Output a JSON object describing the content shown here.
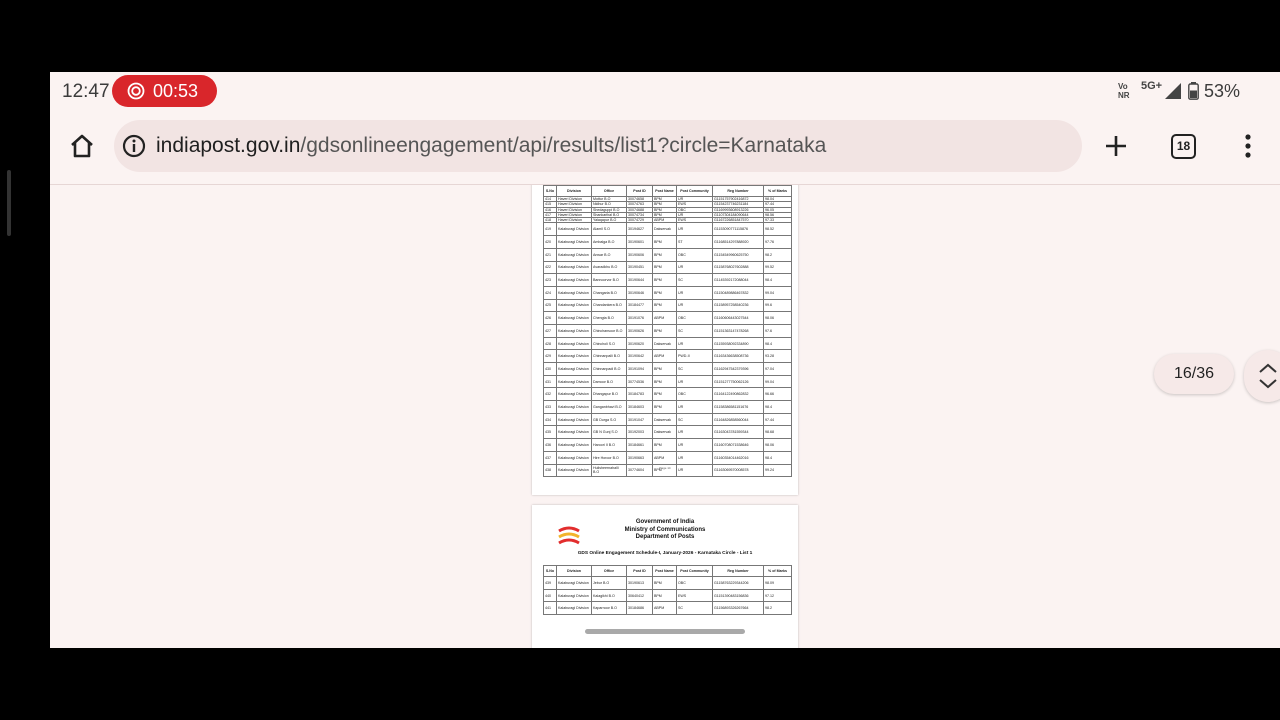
{
  "status_bar": {
    "time": "12:47",
    "recording_time": "00:53",
    "network_type": "Vo\nNR",
    "network_gen": "5G+",
    "battery": "53%"
  },
  "browser": {
    "url_domain": "indiapost.gov.in",
    "url_path": "/gdsonlineengagement/api/results/list1?circle=Karnataka",
    "tab_count": "18",
    "icons": {
      "home": "home-icon",
      "info": "info-icon",
      "new_tab": "plus-icon",
      "menu": "more-vert-icon"
    }
  },
  "pdf": {
    "page_indicator": "16/36",
    "columns": [
      "S.No",
      "Division",
      "Office",
      "Post ID",
      "Post Name",
      "Post Community",
      "Reg Number",
      "% of Marks"
    ],
    "page_a_rows": [
      [
        "414",
        "Haveri Division",
        "Mottur B.O",
        "30074658",
        "BPM",
        "UR",
        "G1151757902416872",
        "98.04"
      ],
      [
        "415",
        "Haveri Division",
        "Nidhur B.O",
        "30074763",
        "BPM",
        "EWS",
        "G1154237746231184",
        "97.44"
      ],
      [
        "416",
        "Haveri Division",
        "Shedaguppi B.O",
        "30074688",
        "BPM",
        "OBC",
        "G1169993608913226",
        "96.05"
      ],
      [
        "417",
        "Haveri Division",
        "Shankarihal B.O",
        "30074734",
        "BPM",
        "UR",
        "G1107304184090644",
        "98.56"
      ],
      [
        "418",
        "Haveri Division",
        "Yalaqapur B.O",
        "30074729",
        "ABPM",
        "EWS",
        "G1167226851847570",
        "97.33"
      ],
      [
        "419",
        "Kalaburagi Division",
        "Alamil S.O",
        "30194627",
        "Dakservak",
        "UR",
        "G1153090771115876",
        "98.52"
      ],
      [
        "420",
        "Kalaburagi Division",
        "Ambalga B.O",
        "30190601",
        "BPM",
        "ST",
        "G1168514297888920",
        "97.76"
      ],
      [
        "421",
        "Kalaburagi Division",
        "Anwar B.O",
        "30190606",
        "BPM",
        "OBC",
        "G1154549960625750",
        "98.2"
      ],
      [
        "422",
        "Kalaburagi Division",
        "Avaradkhu B.O",
        "30190451",
        "BPM",
        "UR",
        "G1158768027602888",
        "99.52"
      ],
      [
        "423",
        "Kalaburagi Division",
        "Bannoorvor B.O",
        "30190644",
        "BPM",
        "SC",
        "G1145392172088044",
        "98.4"
      ],
      [
        "424",
        "Kalaburagi Division",
        "Changaria B.O",
        "30190646",
        "BPM",
        "UR",
        "G1150489886467832",
        "99.04"
      ],
      [
        "425",
        "Kalaburagi Division",
        "Chandankera B.O",
        "30184477",
        "BPM",
        "UR",
        "G1158957258540236",
        "99.6"
      ],
      [
        "426",
        "Kalaburagi Division",
        "Chengta B.O",
        "30191076",
        "ABPM",
        "OBC",
        "G1160606443027544",
        "98.06"
      ],
      [
        "427",
        "Kalaburagi Division",
        "Chinchansoor B.O",
        "30190626",
        "BPM",
        "SC",
        "G1151363147478268",
        "97.6"
      ],
      [
        "428",
        "Kalaburagi Division",
        "Chincholi S.O",
        "30190620",
        "Dakservak",
        "UR",
        "G1155938092334890",
        "98.4"
      ],
      [
        "429",
        "Kalaburagi Division",
        "Chinnanpalli B.O",
        "30190642",
        "ABPM",
        "PWD-II",
        "G1163436638508736",
        "93.28"
      ],
      [
        "430",
        "Kalaburagi Division",
        "Chinnanpadi B.O",
        "30191094",
        "BPM",
        "SC",
        "G1162947542379396",
        "97.04"
      ],
      [
        "431",
        "Kalaburagi Division",
        "Damoor B.O",
        "30774536",
        "BPM",
        "UR",
        "G1151277750062126",
        "99.04"
      ],
      [
        "432",
        "Kalaburagi Division",
        "Dhangapur B.O",
        "30184783",
        "BPM",
        "OBC",
        "G1164122490862832",
        "96.66"
      ],
      [
        "433",
        "Kalaburagi Division",
        "Ganganbhavi B.O",
        "30184603",
        "BPM",
        "UR",
        "G1158386581151676",
        "98.4"
      ],
      [
        "434",
        "Kalaburagi Division",
        "GB Durga S.O",
        "30191047",
        "Dakservak",
        "SC",
        "G1164826858560044",
        "97.44"
      ],
      [
        "435",
        "Kalaburagi Division",
        "GB N Gunj S.O",
        "30192003",
        "Dakservak",
        "UR",
        "G1163043781559344",
        "98.68"
      ],
      [
        "436",
        "Kalaburagi Division",
        "Haroori II B.O",
        "30184661",
        "BPM",
        "UR",
        "G1160708071538646",
        "98.06"
      ],
      [
        "437",
        "Kalaburagi Division",
        "Hire Horoor B.O",
        "30190663",
        "ABPM",
        "UR",
        "G1160354014462016",
        "98.4"
      ],
      [
        "438",
        "Kalaburagi Division",
        "Hulisheernahalli B.O",
        "30774604",
        "BPM",
        "UR",
        "G1163069570008578",
        "99.24"
      ]
    ],
    "page_a_footer": "Page 14",
    "page_b_header": [
      "Government of India",
      "Ministry of Communications",
      "Department of Posts"
    ],
    "page_b_schedule": "GDS Online Engagement Schedule-I, January-2026 - Karnataka Circle - List 1",
    "page_b_rows": [
      [
        "439",
        "Kalaburagi Division",
        "Jebur B.O",
        "30190613",
        "BPM",
        "OBC",
        "G1158763229344206",
        "98.09"
      ],
      [
        "440",
        "Kalaburagi Division",
        "Kalagikhi B.O",
        "30640412",
        "BPM",
        "EWS",
        "G1151390483156836",
        "97.12"
      ],
      [
        "441",
        "Kalaburagi Division",
        "Kaparnoor B.O",
        "30184686",
        "ABPM",
        "SC",
        "G1156893326267664",
        "98.2"
      ]
    ]
  }
}
